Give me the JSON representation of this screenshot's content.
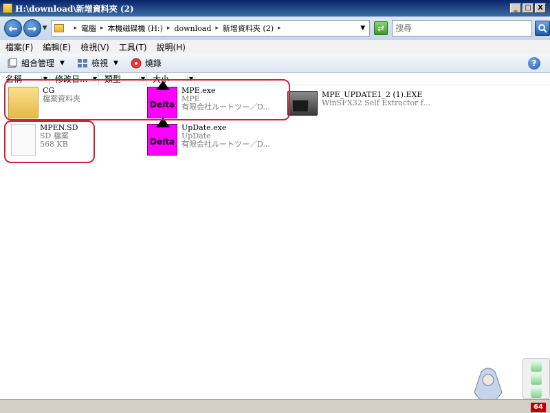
{
  "window": {
    "title": "H:\\download\\新增資料夾 (2)",
    "controls": [
      "_",
      "□",
      "X"
    ]
  },
  "address": {
    "breadcrumbs": [
      "電腦",
      "本機磁碟機 (H:)",
      "download",
      "新增資料夾 (2)"
    ],
    "search_placeholder": "搜尋"
  },
  "menu": {
    "items": [
      "檔案(F)",
      "編輯(E)",
      "檢視(V)",
      "工具(T)",
      "說明(H)"
    ]
  },
  "toolbar": {
    "organize": "組合管理",
    "views": "檢視",
    "burn": "燒錄"
  },
  "columns": [
    "名稱",
    "修改日...",
    "類型",
    "大小"
  ],
  "files": [
    {
      "name": "CG",
      "line2": "檔案資料夾",
      "line3": "",
      "icon": "folder-icon"
    },
    {
      "name": "MPE.exe",
      "line2": "MPE",
      "line3": "有限会社ルートツー／D...",
      "icon": "delta-app-icon"
    },
    {
      "name": "MPE_UPDATE1_2 (1).EXE",
      "line2": "WinSFX32 Self Extractor f...",
      "line3": "",
      "icon": "installer-icon"
    },
    {
      "name": "MPEN.SD",
      "line2": "SD 檔案",
      "line3": "568 KB",
      "icon": "file-icon"
    },
    {
      "name": "UpDate.exe",
      "line2": "UpDate",
      "line3": "有限会社ルートツー／D...",
      "icon": "delta-app-icon"
    }
  ],
  "delta_icon_text": "Delta",
  "tray": {
    "badge": "64"
  }
}
